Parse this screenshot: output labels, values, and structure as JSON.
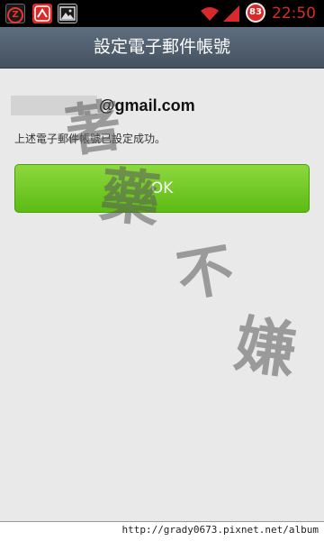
{
  "status_bar": {
    "notification_icons": [
      "z-app-icon",
      "red-app-icon",
      "gallery-icon"
    ],
    "z_label": "Z",
    "battery_level": "83",
    "time": "22:50",
    "accent_color": "#d82a2a"
  },
  "header": {
    "title": "設定電子郵件帳號"
  },
  "main": {
    "email_domain": "@gmail.com",
    "message": "上述電子郵件帳號已設定成功。",
    "ok_label": "OK",
    "button_color": "#6cc423"
  },
  "watermark": {
    "chars": [
      "著",
      "藥",
      "不",
      "嫌"
    ]
  },
  "footer": {
    "url": "http://grady0673.pixnet.net/album"
  }
}
